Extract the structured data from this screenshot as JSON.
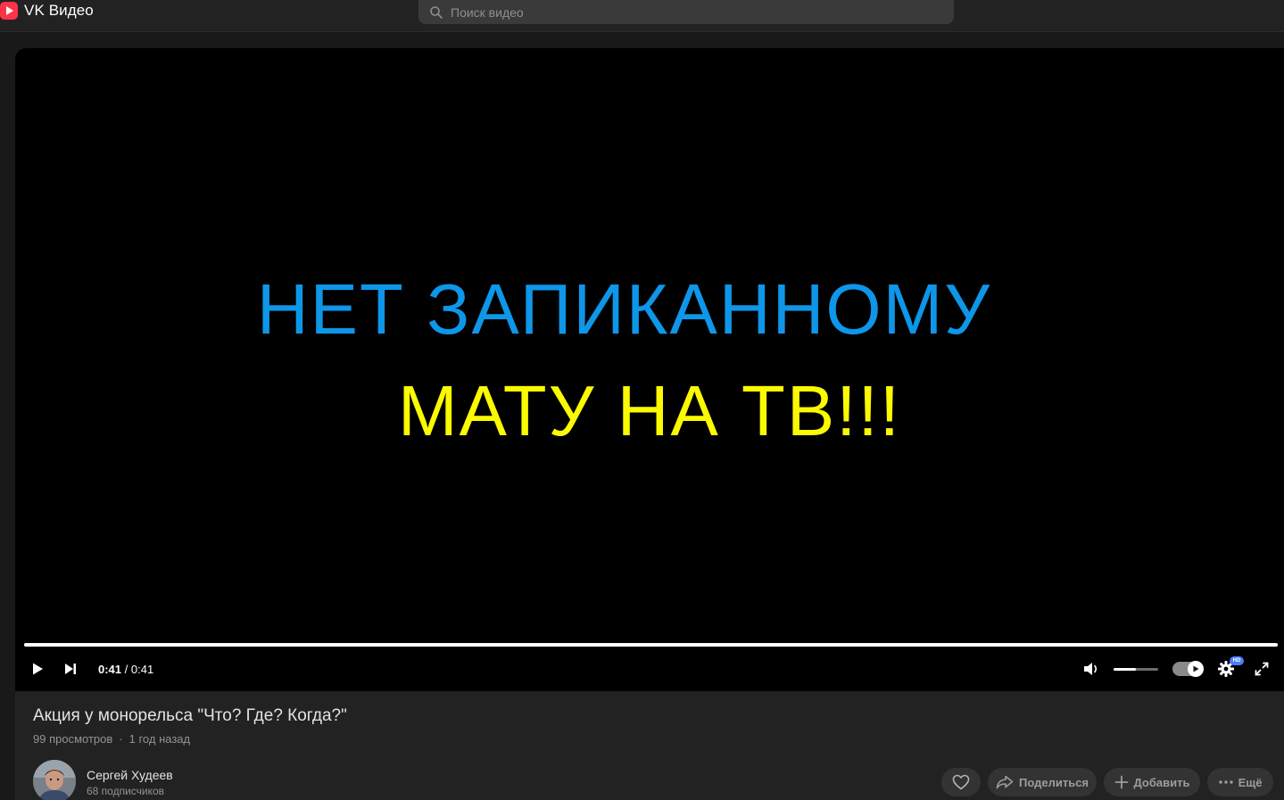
{
  "header": {
    "logo_text": "VK Видео",
    "search_placeholder": "Поиск видео"
  },
  "player": {
    "slide_line1": "НЕТ ЗАПИКАННОМУ",
    "slide_line2": "МАТУ НА ТВ!!!",
    "current_time": "0:41",
    "separator": "/",
    "duration": "0:41",
    "progress_fraction": 1.0,
    "volume_fraction": 0.5,
    "autoplay_on": true,
    "quality_badge": "HD",
    "colors": {
      "line1": "#0e96e8",
      "line2": "#fafa00"
    }
  },
  "video": {
    "title": "Акция у монорельса \"Что? Где? Когда?\"",
    "views": "99 просмотров",
    "meta_dot": "·",
    "age": "1 год назад"
  },
  "author": {
    "name": "Сергей Худеев",
    "subscribers": "68 подписчиков"
  },
  "actions": {
    "share_label": "Поделиться",
    "add_label": "Добавить",
    "more_label": "Ещё"
  },
  "icons": {
    "logo": "vk-video-logo-icon",
    "search": "search-icon",
    "play": "play-icon",
    "next": "next-icon",
    "volume": "volume-icon",
    "settings": "gear-icon",
    "fullscreen": "fullscreen-icon",
    "like": "heart-icon",
    "share": "share-icon",
    "add": "plus-icon",
    "more": "more-dots-icon"
  }
}
